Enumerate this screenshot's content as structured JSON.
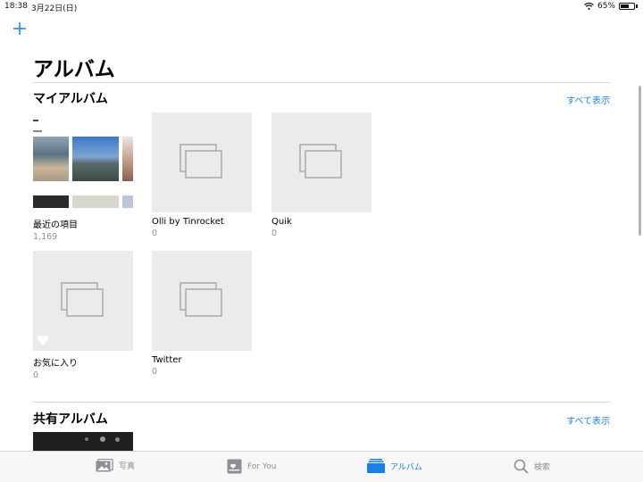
{
  "status_bar": {
    "time": "18:38",
    "date": "3月22日(日)",
    "battery": "65%",
    "battery_level": 0.65
  },
  "colors": {
    "accent": "#1a7fe6",
    "secondary_text": "#8e8e93",
    "placeholder_bg": "#ebebeb"
  },
  "header": {
    "title": "アルバム",
    "add_icon": "plus-icon"
  },
  "my_albums": {
    "title": "マイアルバム",
    "see_all": "すべて表示",
    "albums": [
      {
        "name": "最近の項目",
        "count": "1,169"
      },
      {
        "name": "Olli by Tinrocket",
        "count": "0"
      },
      {
        "name": "Quik",
        "count": "0"
      },
      {
        "name": "お気に入り",
        "count": "0",
        "icon": "heart-icon"
      },
      {
        "name": "Twitter",
        "count": "0"
      }
    ]
  },
  "shared_albums": {
    "title": "共有アルバム",
    "see_all": "すべて表示"
  },
  "tab_bar": {
    "tabs": [
      {
        "label": "写真",
        "icon": "photos-icon"
      },
      {
        "label": "For You",
        "icon": "for-you-icon"
      },
      {
        "label": "アルバム",
        "icon": "albums-icon",
        "active": true
      },
      {
        "label": "検索",
        "icon": "search-icon"
      }
    ]
  }
}
